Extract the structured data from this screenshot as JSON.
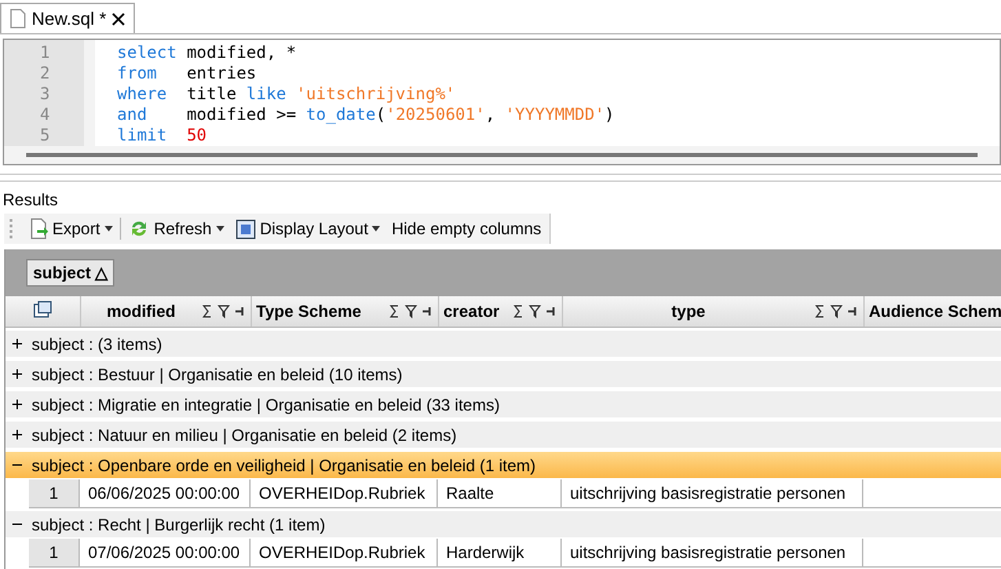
{
  "tabs": [
    {
      "label": "New.sql *",
      "selected": true
    }
  ],
  "editor": {
    "lines": [
      {
        "number": "1",
        "tokens": [
          {
            "kind": "keyword",
            "text": "select"
          },
          {
            "kind": "plain",
            "text": " modified, *"
          }
        ]
      },
      {
        "number": "2",
        "tokens": [
          {
            "kind": "keyword",
            "text": "from"
          },
          {
            "kind": "plain",
            "text": "   entries"
          }
        ]
      },
      {
        "number": "3",
        "tokens": [
          {
            "kind": "keyword",
            "text": "where"
          },
          {
            "kind": "plain",
            "text": "  title "
          },
          {
            "kind": "keyword",
            "text": "like"
          },
          {
            "kind": "string",
            "text": " 'uitschrijving%'"
          }
        ]
      },
      {
        "number": "4",
        "tokens": [
          {
            "kind": "keyword",
            "text": "and"
          },
          {
            "kind": "plain",
            "text": "    modified >= "
          },
          {
            "kind": "keyword",
            "text": "to_date"
          },
          {
            "kind": "plain",
            "text": "("
          },
          {
            "kind": "string",
            "text": "'20250601'"
          },
          {
            "kind": "plain",
            "text": ", "
          },
          {
            "kind": "string",
            "text": "'YYYYMMDD'"
          },
          {
            "kind": "plain",
            "text": ")"
          }
        ]
      },
      {
        "number": "5",
        "tokens": [
          {
            "kind": "keyword",
            "text": "limit"
          },
          {
            "kind": "number",
            "text": "  50"
          }
        ]
      }
    ]
  },
  "results": {
    "title": "Results",
    "toolbar": [
      {
        "kind": "export",
        "label": "Export",
        "dropdown": true
      },
      {
        "kind": "refresh",
        "label": "Refresh",
        "dropdown": true
      },
      {
        "kind": "layout",
        "label": "Display Layout",
        "dropdown": true
      },
      {
        "kind": "plain",
        "label": "Hide empty columns",
        "dropdown": false
      }
    ],
    "group_by": {
      "label": "subject",
      "sort": "△"
    },
    "columns": [
      {
        "label": "modified"
      },
      {
        "label": "Type Scheme"
      },
      {
        "label": "creator"
      },
      {
        "label": "type"
      },
      {
        "label": "Audience Schem"
      }
    ],
    "groups": [
      {
        "label": "subject :  (3 items)",
        "expanded": false,
        "selected": false
      },
      {
        "label": "subject : Bestuur | Organisatie en beleid (10 items)",
        "expanded": false,
        "selected": false
      },
      {
        "label": "subject : Migratie en integratie | Organisatie en beleid (33 items)",
        "expanded": false,
        "selected": false
      },
      {
        "label": "subject : Natuur en milieu | Organisatie en beleid (2 items)",
        "expanded": false,
        "selected": false
      },
      {
        "label": "subject : Openbare orde en veiligheid | Organisatie en beleid (1 item)",
        "expanded": true,
        "selected": true,
        "rows": [
          {
            "number": "1",
            "cells": [
              "06/06/2025 00:00:00",
              "OVERHEIDop.Rubriek",
              "Raalte",
              "uitschrijving basisregistratie personen"
            ]
          }
        ]
      },
      {
        "label": "subject : Recht | Burgerlijk recht (1 item)",
        "expanded": true,
        "selected": false,
        "rows": [
          {
            "number": "1",
            "cells": [
              "07/06/2025 00:00:00",
              "OVERHEIDop.Rubriek",
              "Harderwijk",
              "uitschrijving basisregistratie personen"
            ]
          }
        ]
      }
    ]
  }
}
